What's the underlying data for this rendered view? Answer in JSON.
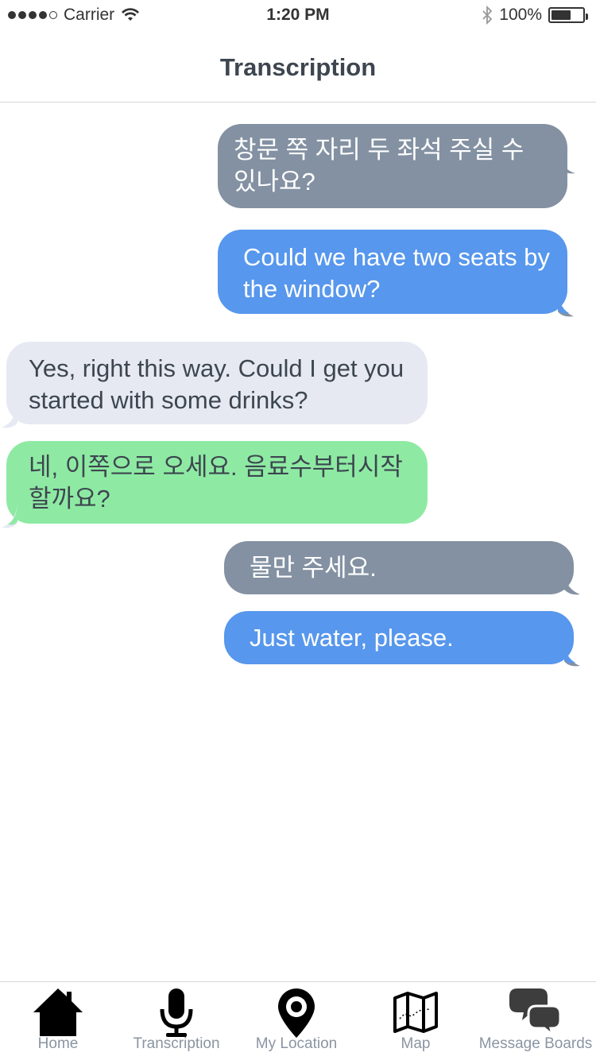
{
  "status_bar": {
    "carrier": "Carrier",
    "time": "1:20 PM",
    "battery": "100%"
  },
  "header": {
    "title": "Transcription"
  },
  "messages": [
    {
      "text": "창문 쪽 자리 두 좌석 주실 수 있나요?",
      "side": "right",
      "color": "#8391a2"
    },
    {
      "text": "Could we have two seats by the window?",
      "side": "right",
      "color": "#5797ed"
    },
    {
      "text": "Yes, right this way. Could I get you started with some drinks?",
      "side": "left",
      "color": "#e6e9f2"
    },
    {
      "text": "네, 이쪽으로 오세요. 음료수부터시작 할까요?",
      "side": "left",
      "color": "#8eeaa3"
    },
    {
      "text": "물만 주세요.",
      "side": "right",
      "color": "#8391a2"
    },
    {
      "text": "Just water, please.",
      "side": "right",
      "color": "#5797ed"
    }
  ],
  "tabs": [
    {
      "label": "Home",
      "icon": "home-icon"
    },
    {
      "label": "Transcription",
      "icon": "microphone-icon"
    },
    {
      "label": "My Location",
      "icon": "location-pin-icon"
    },
    {
      "label": "Map",
      "icon": "map-icon"
    },
    {
      "label": "Message Boards",
      "icon": "chat-bubbles-icon"
    }
  ]
}
